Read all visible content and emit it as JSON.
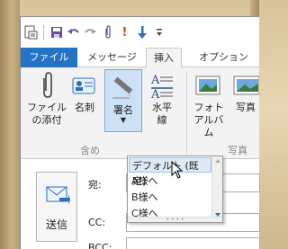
{
  "quick_access": {
    "icons": [
      "new-item-icon",
      "save-icon",
      "undo-icon",
      "redo-icon",
      "attach-icon",
      "importance-icon",
      "download-icon",
      "customize-icon"
    ],
    "importance_glyph": "!"
  },
  "tabs": [
    {
      "label": "ファイル"
    },
    {
      "label": "メッセージ"
    },
    {
      "label": "挿入"
    },
    {
      "label": "オプション"
    }
  ],
  "ribbon": {
    "attach_file": {
      "label_line1": "ファイル",
      "label_line2": "の添付"
    },
    "business_card": {
      "label": "名刺"
    },
    "signature": {
      "label": "署名"
    },
    "horizontal_line": {
      "label_line1": "水平",
      "label_line2": "線"
    },
    "photo_album": {
      "label_line1": "フォト",
      "label_line2": "アルバム"
    },
    "photo": {
      "label": "写真"
    },
    "group_include": "含め",
    "group_photo": "写真"
  },
  "signature_menu": {
    "items": [
      "デフォルト (既定)",
      "A様へ",
      "B様へ",
      "C様へ"
    ]
  },
  "compose": {
    "send_label": "送信",
    "to_label": "宛:",
    "cc_label": "CC:",
    "bcc_label": "BCC:"
  }
}
